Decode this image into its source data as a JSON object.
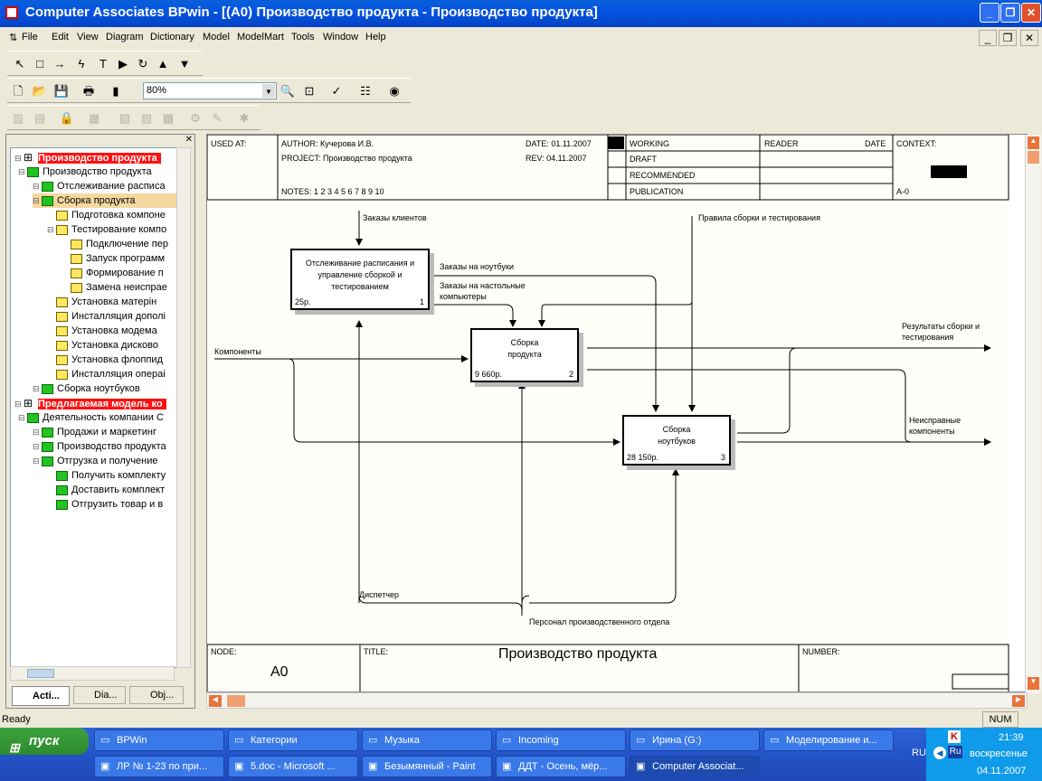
{
  "window": {
    "title": "Computer Associates BPwin - [(A0) Производство продукта - Производство продукта]"
  },
  "menu": [
    "File",
    "Edit",
    "View",
    "Diagram",
    "Dictionary",
    "Model",
    "ModelMart",
    "Tools",
    "Window",
    "Help"
  ],
  "toolbar": {
    "zoom": "80%"
  },
  "tree": {
    "items": [
      {
        "label": "Производство продукта",
        "level": 0,
        "header": true
      },
      {
        "label": "Производство продукта",
        "level": 1,
        "icon": "green"
      },
      {
        "label": "Отслеживание расписа",
        "level": 2,
        "icon": "green"
      },
      {
        "label": "Сборка продукта",
        "level": 2,
        "icon": "green",
        "selected": true
      },
      {
        "label": "Подготовка компоне",
        "level": 3,
        "icon": "yellow"
      },
      {
        "label": "Тестирование компо",
        "level": 3,
        "icon": "yellow"
      },
      {
        "label": "Подключение пер",
        "level": 4,
        "icon": "yellow"
      },
      {
        "label": "Запуск программ",
        "level": 4,
        "icon": "yellow"
      },
      {
        "label": "Формирование п",
        "level": 4,
        "icon": "yellow"
      },
      {
        "label": "Замена неиспрае",
        "level": 4,
        "icon": "yellow"
      },
      {
        "label": "Установка матерін",
        "level": 3,
        "icon": "yellow"
      },
      {
        "label": "Инсталляция дополі",
        "level": 3,
        "icon": "yellow"
      },
      {
        "label": "Установка модема",
        "level": 3,
        "icon": "yellow"
      },
      {
        "label": "Установка дисково",
        "level": 3,
        "icon": "yellow"
      },
      {
        "label": "Установка флоппид",
        "level": 3,
        "icon": "yellow"
      },
      {
        "label": "Инсталляция операі",
        "level": 3,
        "icon": "yellow"
      },
      {
        "label": "Сборка ноутбуков",
        "level": 2,
        "icon": "green"
      },
      {
        "label": "Предлагаемая модель ко",
        "level": 0,
        "header": true
      },
      {
        "label": "Деятельность компании С",
        "level": 1,
        "icon": "green"
      },
      {
        "label": "Продажи и маркетинг",
        "level": 2,
        "icon": "green"
      },
      {
        "label": "Производство продукта",
        "level": 2,
        "icon": "green"
      },
      {
        "label": "Отгрузка и получение",
        "level": 2,
        "icon": "green"
      },
      {
        "label": "Получить комплекту",
        "level": 3,
        "icon": "green"
      },
      {
        "label": "Доставить комплект",
        "level": 3,
        "icon": "green"
      },
      {
        "label": "Отгрузить товар и в",
        "level": 3,
        "icon": "green"
      }
    ]
  },
  "panel_tabs": [
    "Acti...",
    "Dia...",
    "Obj..."
  ],
  "header_frame": {
    "used_at": "USED AT:",
    "author": "AUTHOR:  Кучерова И.В.",
    "project": "PROJECT:  Производство продукта",
    "date": "DATE: 01.11.2007",
    "rev": "REV:   04.11.2007",
    "notes": "NOTES:  1  2  3  4  5  6  7  8  9  10",
    "working": "WORKING",
    "draft": "DRAFT",
    "recommended": "RECOMMENDED",
    "publication": "PUBLICATION",
    "reader": "READER",
    "date2": "DATE",
    "context": "CONTEXT:",
    "context_node": "A-0"
  },
  "activities": [
    {
      "label": "Отслеживание расписания и управление сборкой и тестированием",
      "cost": "25р.",
      "num": "1"
    },
    {
      "label": "Сборка продукта",
      "cost": "9 660р.",
      "num": "2"
    },
    {
      "label": "Сборка ноутбуков",
      "cost": "28 150р.",
      "num": "3"
    }
  ],
  "arrows": {
    "orders": "Заказы клиентов",
    "rules": "Правила сборки и тестирования",
    "notebook_orders": "Заказы на ноутбуки",
    "desktop_orders": "Заказы на настольные компьютеры",
    "components": "Компоненты",
    "results": "Результаты сборки и тестирования",
    "faulty": "Неисправные компоненты",
    "dispatcher": "Диспетчер",
    "staff": "Персонал производственного отдела"
  },
  "footer_frame": {
    "node_label": "NODE:",
    "node": "A0",
    "title_label": "TITLE:",
    "title": "Производство продукта",
    "number_label": "NUMBER:"
  },
  "status": {
    "ready": "Ready",
    "num": "NUM"
  },
  "taskbar": {
    "start": "пуск",
    "row1": [
      "BPWin",
      "Категории",
      "Музыка",
      "Incoming",
      "Ирина (G:)",
      "Моделирование и..."
    ],
    "row2": [
      "ЛР № 1-23 по при...",
      "5.doc - Microsoft ...",
      "Безымянный - Paint",
      "ДДТ - Осень, мёр...",
      "Computer Associat..."
    ],
    "lang": "RU",
    "time": "21:39",
    "day": "воскресенье",
    "date": "04.11.2007"
  }
}
